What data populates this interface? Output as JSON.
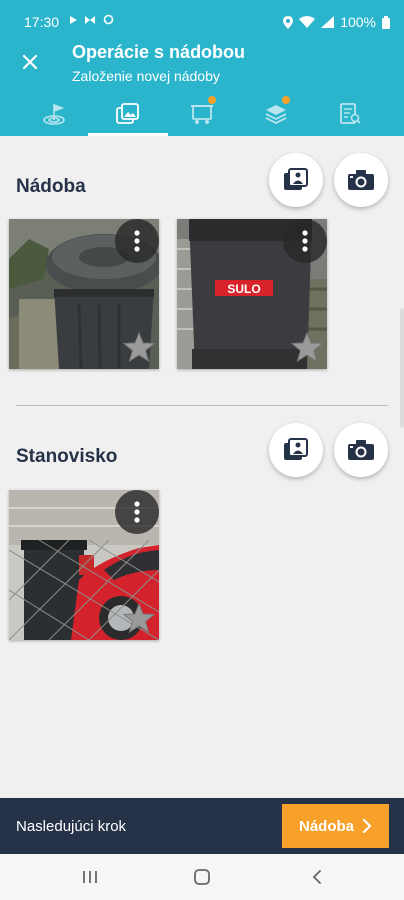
{
  "status_bar": {
    "time": "17:30",
    "battery": "100%",
    "icons": [
      "play-icon",
      "sync-icon",
      "circle-icon",
      "location-icon",
      "wifi-icon",
      "signal-icon",
      "battery-icon"
    ]
  },
  "app_bar": {
    "title": "Operácie s nádobou",
    "subtitle": "Založenie novej nádoby",
    "close_icon": "close-icon"
  },
  "tabs": [
    {
      "icon": "location-flag-icon",
      "active": false,
      "badge": false
    },
    {
      "icon": "photos-icon",
      "active": true,
      "badge": false
    },
    {
      "icon": "container-icon",
      "active": false,
      "badge": true
    },
    {
      "icon": "layers-icon",
      "active": false,
      "badge": true
    },
    {
      "icon": "document-search-icon",
      "active": false,
      "badge": false
    }
  ],
  "sections": [
    {
      "title": "Nádoba",
      "photos": [
        {
          "description": "gray bin with lid",
          "starred": false
        },
        {
          "description": "black bin with SULO label",
          "label": "SULO",
          "starred": false
        }
      ]
    },
    {
      "title": "Stanovisko",
      "photos": [
        {
          "description": "bin behind fence with red car",
          "starred": false
        }
      ]
    }
  ],
  "bottom_bar": {
    "next_step_label": "Nasledujúci krok",
    "next_button_label": "Nádoba"
  },
  "colors": {
    "primary": "#2bb5cc",
    "dark": "#263248",
    "accent": "#f7a12b",
    "background": "#f0f0f0"
  }
}
